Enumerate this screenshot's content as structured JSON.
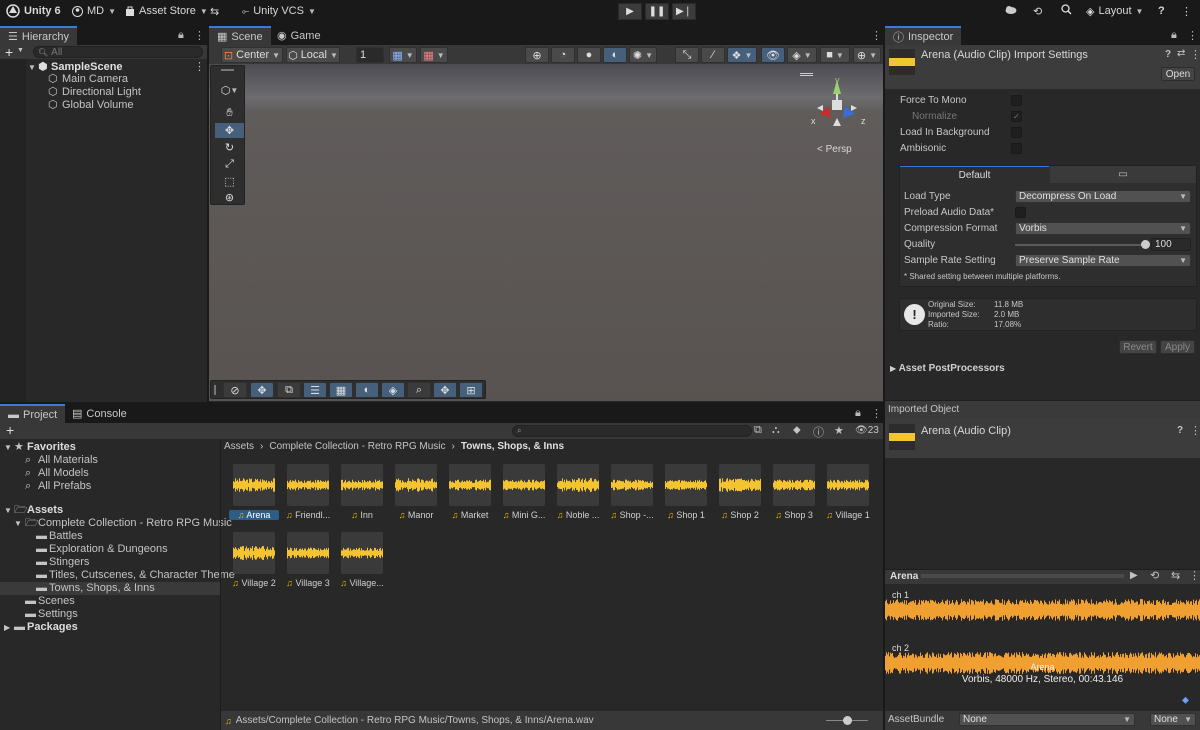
{
  "topbar": {
    "app": "Unity 6",
    "account": "MD",
    "asset_store": "Asset Store",
    "vcs": "Unity VCS",
    "layout": "Layout"
  },
  "hierarchy": {
    "tab": "Hierarchy",
    "search_placeholder": "All",
    "scene": "SampleScene",
    "items": [
      "Main Camera",
      "Directional Light",
      "Global Volume"
    ]
  },
  "scene_panel": {
    "tabs": [
      "Scene",
      "Game"
    ],
    "pivot": "Center",
    "space": "Local",
    "grid_value": "1",
    "persp_label": "Persp",
    "axis_labels": {
      "x": "x",
      "y": "y",
      "z": "z"
    }
  },
  "project": {
    "tabs": [
      "Project",
      "Console"
    ],
    "visible_count": "23",
    "favorites": {
      "label": "Favorites",
      "items": [
        "All Materials",
        "All Models",
        "All Prefabs"
      ]
    },
    "assets": {
      "label": "Assets",
      "collection": "Complete Collection - Retro RPG Music",
      "collection_children": [
        "Battles",
        "Exploration & Dungeons",
        "Stingers",
        "Titles, Cutscenes, & Character Theme",
        "Towns, Shops, & Inns"
      ],
      "other": [
        "Scenes",
        "Settings"
      ]
    },
    "packages": "Packages",
    "breadcrumb": [
      "Assets",
      "Complete Collection - Retro RPG Music",
      "Towns, Shops, & Inns"
    ],
    "files": [
      "Arena",
      "Friendl...",
      "Inn",
      "Manor",
      "Market",
      "Mini G...",
      "Noble ...",
      "Shop -...",
      "Shop 1",
      "Shop 2",
      "Shop 3",
      "Village 1",
      "Village 2",
      "Village 3",
      "Village..."
    ],
    "status_path": "Assets/Complete Collection - Retro RPG Music/Towns, Shops, & Inns/Arena.wav"
  },
  "inspector": {
    "tab": "Inspector",
    "title": "Arena (Audio Clip) Import Settings",
    "open": "Open",
    "force_to_mono": "Force To Mono",
    "normalize": "Normalize",
    "load_in_background": "Load In Background",
    "ambisonic": "Ambisonic",
    "platform_tab": "Default",
    "load_type_label": "Load Type",
    "load_type": "Decompress On Load",
    "preload_label": "Preload Audio Data*",
    "compression_label": "Compression Format",
    "compression": "Vorbis",
    "quality_label": "Quality",
    "quality": "100",
    "quality_value": 100,
    "sample_rate_label": "Sample Rate Setting",
    "sample_rate": "Preserve Sample Rate",
    "shared_note": "* Shared setting between multiple platforms.",
    "original_size_label": "Original Size:",
    "original_size": "11.8 MB",
    "imported_size_label": "Imported Size:",
    "imported_size": "2.0 MB",
    "ratio_label": "Ratio:",
    "ratio": "17.08%",
    "revert": "Revert",
    "apply": "Apply",
    "postprocessors": "Asset PostProcessors",
    "imported_object": "Imported Object",
    "object_name": "Arena (Audio Clip)",
    "preview_name": "Arena",
    "ch1": "ch 1",
    "ch2": "ch 2",
    "clip_name": "Arena",
    "clip_info": "Vorbis, 48000 Hz, Stereo, 00:43.146",
    "assetbundle_label": "AssetBundle",
    "assetbundle": "None",
    "variant": "None"
  },
  "colors": {
    "accent": "#3a7bd5",
    "waveform": "#f0a030",
    "thumb_wave": "#f4c430"
  }
}
